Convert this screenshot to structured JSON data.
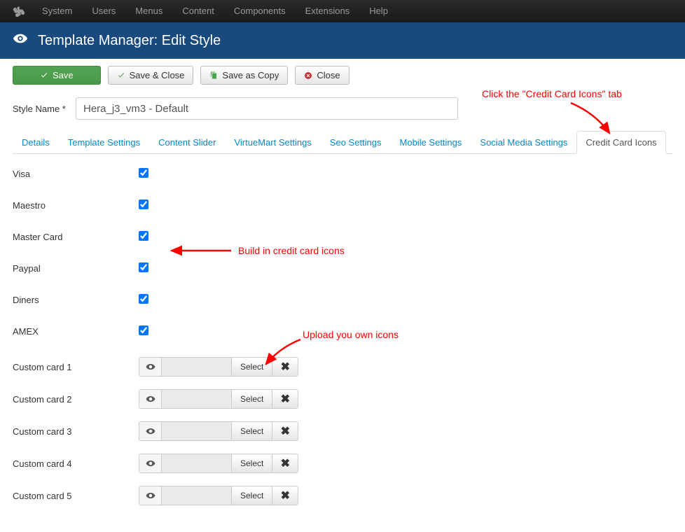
{
  "topnav": {
    "items": [
      "System",
      "Users",
      "Menus",
      "Content",
      "Components",
      "Extensions",
      "Help"
    ]
  },
  "header": {
    "title": "Template Manager: Edit Style"
  },
  "toolbar": {
    "save": "Save",
    "save_close": "Save & Close",
    "save_copy": "Save as Copy",
    "close": "Close"
  },
  "style_name_label": "Style Name *",
  "style_name_value": "Hera_j3_vm3 - Default",
  "tabs": [
    "Details",
    "Template Settings",
    "Content Slider",
    "VirtueMart Settings",
    "Seo Settings",
    "Mobile Settings",
    "Social Media Settings",
    "Credit Card Icons"
  ],
  "builtin_cards": [
    {
      "label": "Visa",
      "checked": true
    },
    {
      "label": "Maestro",
      "checked": true
    },
    {
      "label": "Master Card",
      "checked": true
    },
    {
      "label": "Paypal",
      "checked": true
    },
    {
      "label": "Diners",
      "checked": true
    },
    {
      "label": "AMEX",
      "checked": true
    }
  ],
  "custom_cards": [
    {
      "label": "Custom card 1",
      "select": "Select"
    },
    {
      "label": "Custom card 2",
      "select": "Select"
    },
    {
      "label": "Custom card 3",
      "select": "Select"
    },
    {
      "label": "Custom card 4",
      "select": "Select"
    },
    {
      "label": "Custom card 5",
      "select": "Select"
    }
  ],
  "annotations": {
    "tab_hint": "Click the \"Credit Card Icons\" tab",
    "builtin_hint": "Build in credit card icons",
    "upload_hint": "Upload you own icons"
  }
}
